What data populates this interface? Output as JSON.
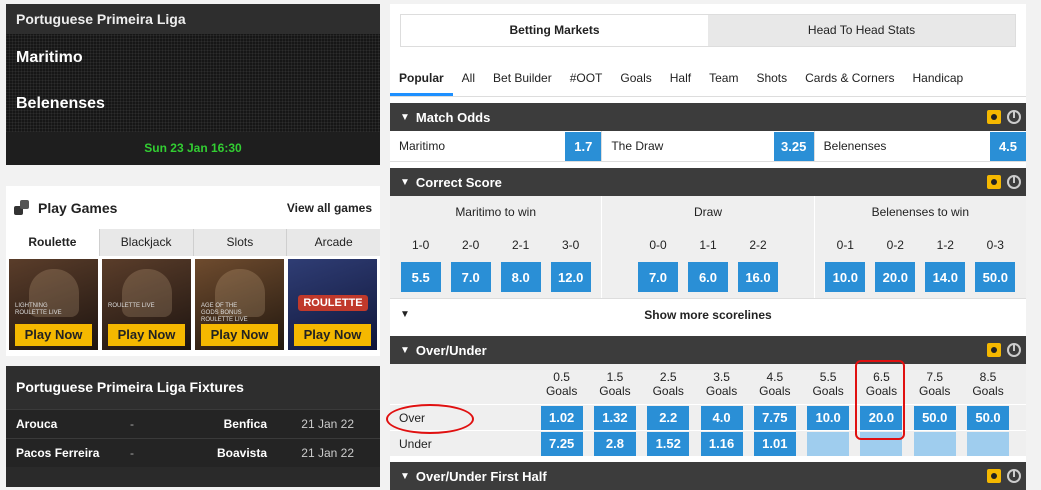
{
  "match": {
    "league": "Portuguese Primeira Liga",
    "home": "Maritimo",
    "away": "Belenenses",
    "kickoff": "Sun 23 Jan 16:30"
  },
  "games": {
    "title": "Play Games",
    "view_all": "View all games",
    "tabs": [
      "Roulette",
      "Blackjack",
      "Slots",
      "Arcade"
    ],
    "tiles": [
      {
        "name": "Lightning Roulette Live",
        "cta": "Play Now"
      },
      {
        "name": "Roulette Live",
        "cta": "Play Now"
      },
      {
        "name": "Age of the Gods Bonus Roulette Live",
        "cta": "Play Now"
      },
      {
        "name": "Roulette",
        "cta": "Play Now"
      }
    ]
  },
  "fixtures": {
    "title": "Portuguese Primeira Liga Fixtures",
    "rows": [
      {
        "home": "Arouca",
        "sep": "-",
        "away": "Benfica",
        "date": "21 Jan 22"
      },
      {
        "home": "Pacos Ferreira",
        "sep": "-",
        "away": "Boavista",
        "date": "21 Jan 22"
      }
    ]
  },
  "view_toggle": [
    "Betting Markets",
    "Head To Head Stats"
  ],
  "market_tabs": [
    "Popular",
    "All",
    "Bet Builder",
    "#OOT",
    "Goals",
    "Half",
    "Team",
    "Shots",
    "Cards & Corners",
    "Handicap"
  ],
  "match_odds": {
    "title": "Match Odds",
    "selections": [
      {
        "name": "Maritimo",
        "price": "1.7"
      },
      {
        "name": "The Draw",
        "price": "3.25"
      },
      {
        "name": "Belenenses",
        "price": "4.5"
      }
    ]
  },
  "correct_score": {
    "title": "Correct Score",
    "columns": [
      {
        "header": "Maritimo to win",
        "scores": [
          "1-0",
          "2-0",
          "2-1",
          "3-0"
        ],
        "prices": [
          "5.5",
          "7.0",
          "8.0",
          "12.0"
        ]
      },
      {
        "header": "Draw",
        "scores": [
          "0-0",
          "1-1",
          "2-2"
        ],
        "prices": [
          "7.0",
          "6.0",
          "16.0"
        ]
      },
      {
        "header": "Belenenses to win",
        "scores": [
          "0-1",
          "0-2",
          "1-2",
          "0-3"
        ],
        "prices": [
          "10.0",
          "20.0",
          "14.0",
          "50.0"
        ]
      }
    ],
    "show_more": "Show more scorelines"
  },
  "over_under": {
    "title": "Over/Under",
    "lines": [
      "0.5",
      "1.5",
      "2.5",
      "3.5",
      "4.5",
      "5.5",
      "6.5",
      "7.5",
      "8.5"
    ],
    "goals_label": "Goals",
    "over": {
      "label": "Over",
      "prices": [
        "1.02",
        "1.32",
        "2.2",
        "4.0",
        "7.75",
        "10.0",
        "20.0",
        "50.0",
        "50.0"
      ]
    },
    "under": {
      "label": "Under",
      "prices": [
        "7.25",
        "2.8",
        "1.52",
        "1.16",
        "1.01",
        "",
        "",
        "",
        ""
      ]
    }
  },
  "over_under_fh": {
    "title": "Over/Under First Half"
  },
  "colors": {
    "price_blue": "#2a8fd6",
    "highlight_red": "#e01010",
    "kickoff_green": "#32cd32",
    "accent_yellow": "#f5b800"
  }
}
